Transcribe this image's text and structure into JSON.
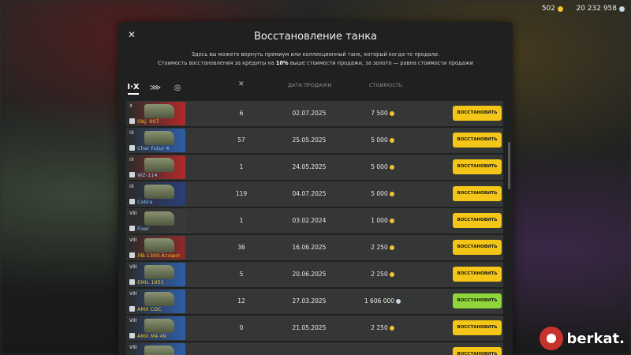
{
  "currency": {
    "gold": "502",
    "credits": "20 232 958"
  },
  "dialog": {
    "title": "Восстановление танка",
    "desc_line1": "Здесь вы можете вернуть премиум или коллекционный танк, который когда-то продали.",
    "desc_line2_a": "Стоимость восстановления за кредиты на ",
    "desc_line2_b": "10%",
    "desc_line2_c": " выше стоимости продажи, за золото — равна стоимости продажи"
  },
  "filters": {
    "tier_label": "I·X"
  },
  "columns": {
    "battles": "✕",
    "date": "ДАТА ПРОДАЖИ",
    "cost": "СТОИМОСТЬ"
  },
  "rows": [
    {
      "tier": "X",
      "name": "Obj. 907",
      "name_color": "gold",
      "flag": "#b22a2a",
      "battles": "6",
      "date": "02.07.2025",
      "cost": "7 500",
      "currency": "gold",
      "button": "ВОССТАНОВИТЬ",
      "button_color": "yellow"
    },
    {
      "tier": "IX",
      "name": "Char Futur 4",
      "name_color": "blue",
      "flag": "#2f5fa8",
      "battles": "57",
      "date": "25.05.2025",
      "cost": "5 000",
      "currency": "gold",
      "button": "ВОССТАНОВИТЬ",
      "button_color": "yellow"
    },
    {
      "tier": "IX",
      "name": "WZ-114",
      "name_color": "blue",
      "flag": "#b22a2a",
      "battles": "1",
      "date": "24.05.2025",
      "cost": "5 000",
      "currency": "gold",
      "button": "ВОССТАНОВИТЬ",
      "button_color": "yellow"
    },
    {
      "tier": "IX",
      "name": "Cobra",
      "name_color": "blue",
      "flag": "#2a3f78",
      "battles": "119",
      "date": "04.07.2025",
      "cost": "5 000",
      "currency": "gold",
      "button": "ВОССТАНОВИТЬ",
      "button_color": "yellow"
    },
    {
      "tier": "VIII",
      "name": "Fixer",
      "name_color": "blue",
      "flag": "#3a3a3a",
      "battles": "1",
      "date": "03.02.2024",
      "cost": "1 000",
      "currency": "gold",
      "button": "ВОССТАНОВИТЬ",
      "button_color": "yellow"
    },
    {
      "tier": "VIII",
      "name": "ЛВ-1300 Атлант",
      "name_color": "gold",
      "flag": "#8a2a2a",
      "battles": "36",
      "date": "16.06.2025",
      "cost": "2 250",
      "currency": "gold",
      "button": "ВОССТАНОВИТЬ",
      "button_color": "yellow"
    },
    {
      "tier": "VIII",
      "name": "EMIL 1951",
      "name_color": "gold",
      "flag": "#2f5fa8",
      "battles": "5",
      "date": "20.06.2025",
      "cost": "2 250",
      "currency": "gold",
      "button": "ВОССТАНОВИТЬ",
      "button_color": "yellow"
    },
    {
      "tier": "VIII",
      "name": "AMX CDC",
      "name_color": "gold",
      "flag": "#2f5fa8",
      "battles": "12",
      "date": "27.03.2025",
      "cost": "1 606 000",
      "currency": "credits",
      "button": "ВОССТАНОВИТЬ",
      "button_color": "green"
    },
    {
      "tier": "VIII",
      "name": "AMX M4 49",
      "name_color": "gold",
      "flag": "#2f5fa8",
      "battles": "0",
      "date": "21.05.2025",
      "cost": "2 250",
      "currency": "gold",
      "button": "ВОССТАНОВИТЬ",
      "button_color": "yellow"
    },
    {
      "tier": "VIII",
      "name": "",
      "name_color": "gold",
      "flag": "#2f5fa8",
      "battles": "",
      "date": "",
      "cost": "",
      "currency": "gold",
      "button": "ВОССТАНОВИТЬ",
      "button_color": "yellow"
    }
  ],
  "watermark": {
    "text": "berkat."
  }
}
